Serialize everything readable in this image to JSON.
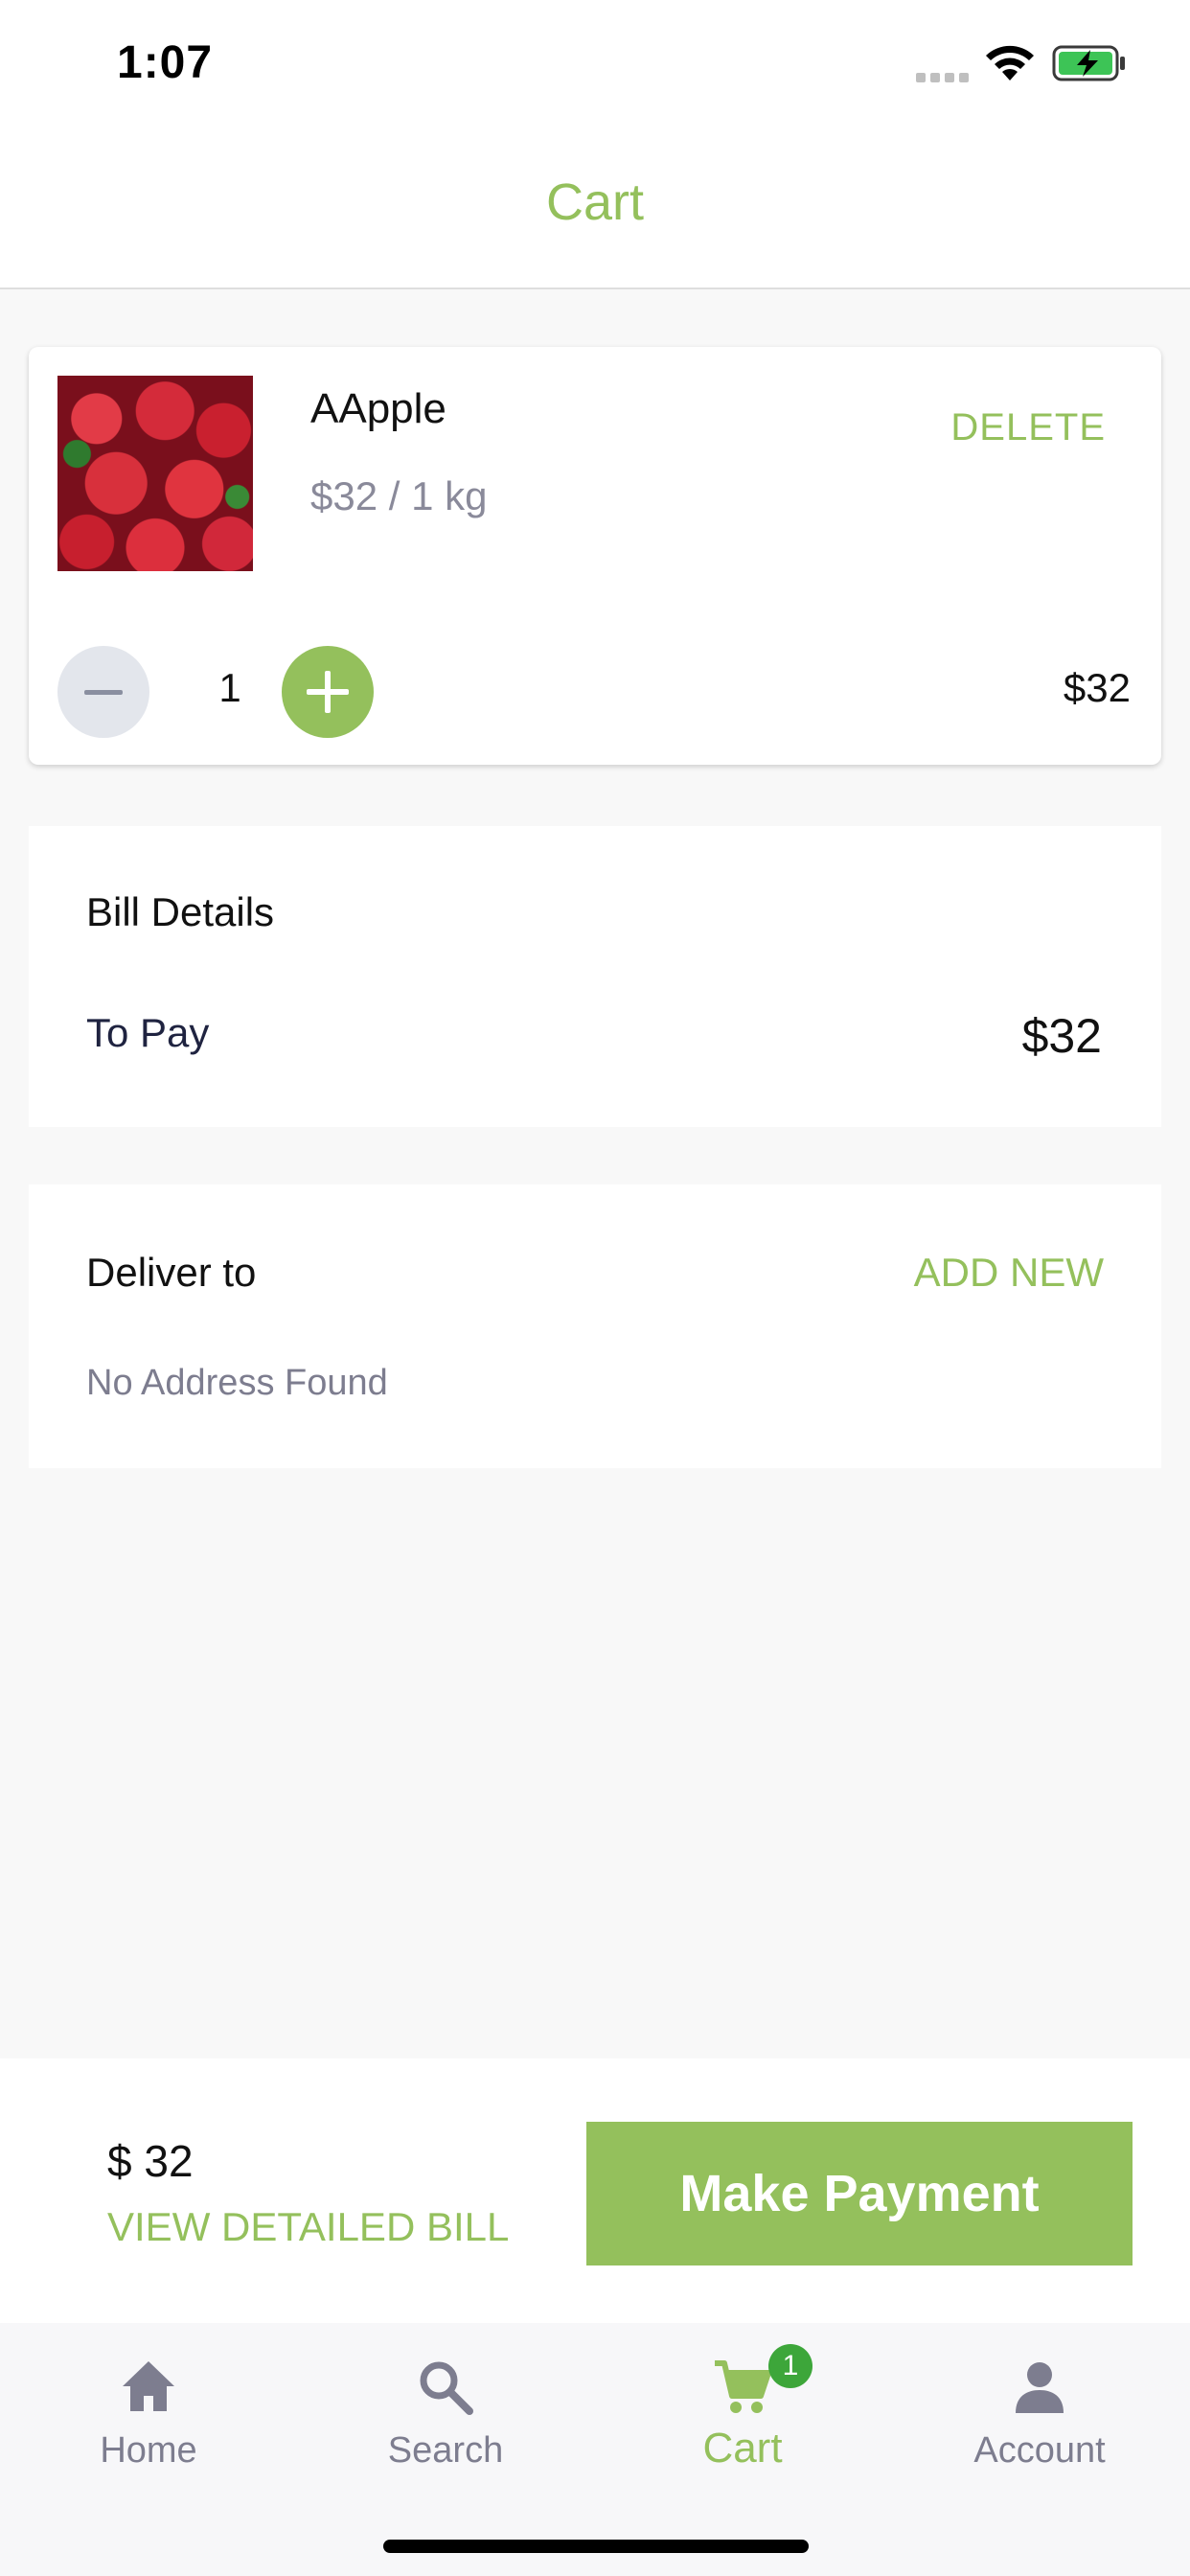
{
  "status_bar": {
    "time": "1:07"
  },
  "header": {
    "title": "Cart"
  },
  "cart_item": {
    "name": "AApple",
    "price": "$32 / 1 kg",
    "delete_label": "DELETE",
    "quantity": "1",
    "line_total": "$32"
  },
  "bill": {
    "title": "Bill Details",
    "to_pay_label": "To Pay",
    "to_pay_value": "$32"
  },
  "delivery": {
    "title": "Deliver to",
    "add_new_label": "ADD NEW",
    "empty_message": "No Address Found"
  },
  "payment_bar": {
    "total": "$ 32",
    "view_bill_label": "VIEW DETAILED BILL",
    "pay_button_label": "Make Payment"
  },
  "bottom_nav": {
    "items": [
      {
        "label": "Home",
        "icon": "home-icon",
        "active": false
      },
      {
        "label": "Search",
        "icon": "search-icon",
        "active": false
      },
      {
        "label": "Cart",
        "icon": "cart-icon",
        "active": true,
        "badge": "1"
      },
      {
        "label": "Account",
        "icon": "account-icon",
        "active": false
      }
    ]
  },
  "colors": {
    "accent": "#94c05c",
    "badge": "#3da63a",
    "muted": "#7d7d8f"
  }
}
